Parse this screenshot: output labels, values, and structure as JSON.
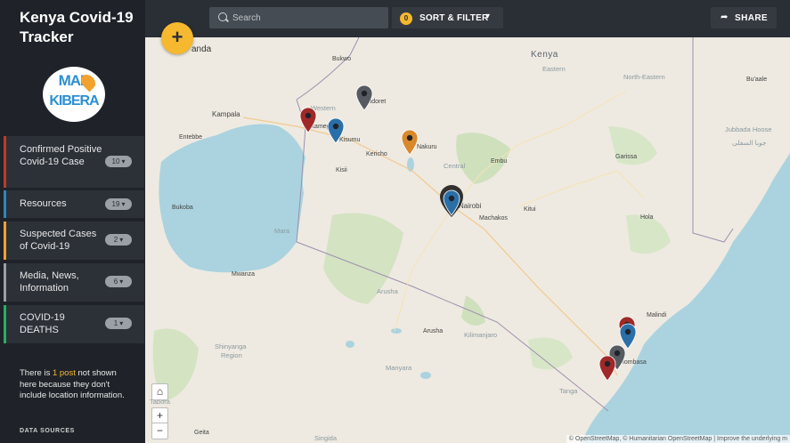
{
  "app": {
    "title": "Kenya Covid-19 Tracker",
    "logo_top": "MAP",
    "logo_bottom": "KIBERA"
  },
  "sidebar": {
    "categories": [
      {
        "label": "Confirmed Positive Covid-19 Case",
        "count": "10",
        "color": "#c0392b"
      },
      {
        "label": "Resources",
        "count": "19",
        "color": "#2e86c1"
      },
      {
        "label": "Suspected Cases of Covid-19",
        "count": "2",
        "color": "#f0a030"
      },
      {
        "label": "Media, News, Information",
        "count": "6",
        "color": "#9aa0a6"
      },
      {
        "label": "COVID-19 DEATHS",
        "count": "1",
        "color": "#27ae60"
      }
    ],
    "notice_pre": "There is ",
    "notice_link": "1 post",
    "notice_post": " not shown here because they don't include location information.",
    "data_sources": "DATA SOURCES"
  },
  "topbar": {
    "search_placeholder": "Search",
    "filter_count": "0",
    "sort_filter_label": "SORT & FILTER",
    "share_label": "SHARE"
  },
  "map": {
    "add_label": "+",
    "home_label": "⌂",
    "zoom_in": "+",
    "zoom_out": "−",
    "attribution": "© OpenStreetMap, © Humanitarian OpenStreetMap | Improve the underlying m",
    "labels": {
      "uganda": "anda",
      "kampala": "Kampala",
      "entebbe": "Entebbe",
      "bukwo": "Bukwo",
      "western": "Western",
      "eldoret": "Eldoret",
      "kakamega": "Kakamega",
      "kisumu": "Kisumu",
      "kericho": "Kericho",
      "nakuru": "Nakuru",
      "kisii": "Kisii",
      "kenya": "Kenya",
      "eastern": "Eastern",
      "north_eastern": "North-Eastern",
      "buaale": "Bu'aale",
      "jubbada_hoose": "Jubbada Hoose",
      "jubbada_arabic": "جوبا السفلى",
      "garissa": "Garissa",
      "embu": "Embu",
      "nairobi": "Nairobi",
      "machakos": "Machakos",
      "kitui": "Kitui",
      "hola": "Hola",
      "central": "Central",
      "bukoba": "Bukoba",
      "mara": "Mara",
      "mwanza": "Mwanza",
      "arusha_region": "Arusha",
      "arusha": "Arusha",
      "kilimanjaro": "Kilimanjaro",
      "malindi": "Malindi",
      "mombasa": "Mombasa",
      "shinyanga": "Shinyanga",
      "shinyanga2": "Region",
      "manyara": "Manyara",
      "tanga": "Tanga",
      "geita": "Geita",
      "singida": "Singida",
      "tabora": "Tabora"
    },
    "markers": [
      {
        "name": "eldoret-marker",
        "color": "#555b61"
      },
      {
        "name": "kakamega-marker",
        "color": "#a12828"
      },
      {
        "name": "kisumu-marker",
        "color": "#2b6fa8"
      },
      {
        "name": "nakuru-marker",
        "color": "#d9882a"
      },
      {
        "name": "nairobi-marker",
        "color": "#2b6fa8"
      },
      {
        "name": "malindi-marker-red",
        "color": "#a12828"
      },
      {
        "name": "malindi-marker-blue",
        "color": "#2b6fa8"
      },
      {
        "name": "mombasa-marker-gray",
        "color": "#555b61"
      },
      {
        "name": "mombasa-marker-red",
        "color": "#a12828"
      }
    ]
  }
}
